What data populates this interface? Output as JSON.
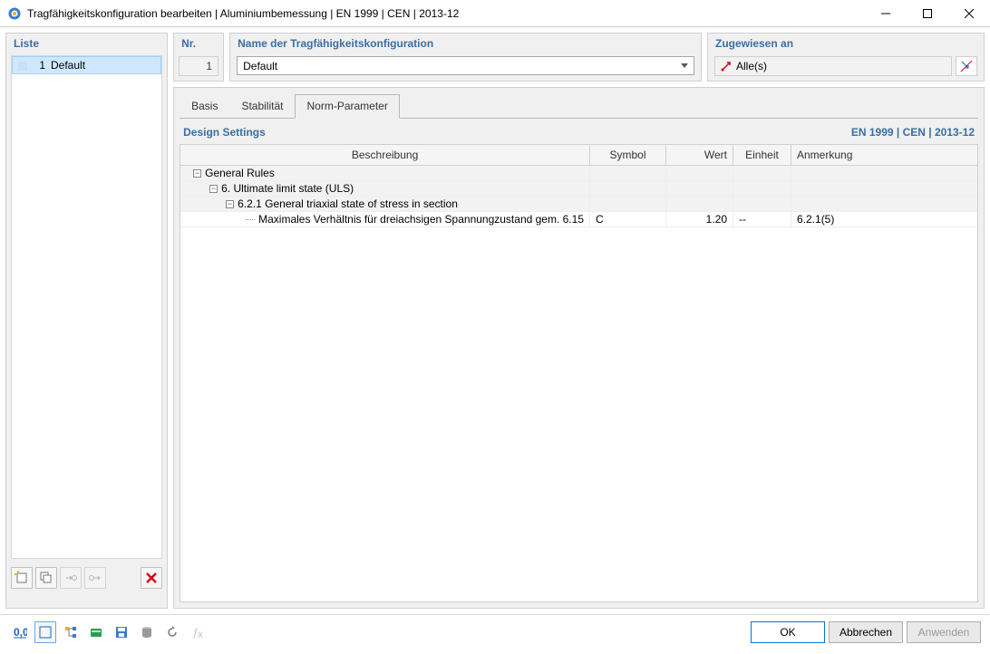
{
  "window": {
    "title": "Tragfähigkeitskonfiguration bearbeiten | Aluminiumbemessung | EN 1999 | CEN | 2013-12"
  },
  "left": {
    "title": "Liste",
    "items": [
      {
        "index": "1",
        "label": "Default"
      }
    ]
  },
  "top": {
    "nr_label": "Nr.",
    "nr_value": "1",
    "name_label": "Name der Tragfähigkeitskonfiguration",
    "name_value": "Default",
    "assigned_label": "Zugewiesen an",
    "assigned_value": "Alle(s)"
  },
  "tabs": {
    "t0": "Basis",
    "t1": "Stabilität",
    "t2": "Norm-Parameter"
  },
  "design": {
    "label": "Design Settings",
    "norm": "EN 1999 | CEN | 2013-12",
    "columns": {
      "desc": "Beschreibung",
      "symbol": "Symbol",
      "value": "Wert",
      "unit": "Einheit",
      "note": "Anmerkung"
    },
    "g0": "General Rules",
    "g1": "6. Ultimate limit state (ULS)",
    "g2": "6.2.1 General triaxial state of stress in section",
    "row0": {
      "desc": "Maximales Verhältnis für dreiachsigen Spannungzustand gem. 6.15",
      "symbol": "C",
      "value": "1.20",
      "unit": "--",
      "note": "6.2.1(5)"
    }
  },
  "buttons": {
    "ok": "OK",
    "cancel": "Abbrechen",
    "apply": "Anwenden"
  }
}
